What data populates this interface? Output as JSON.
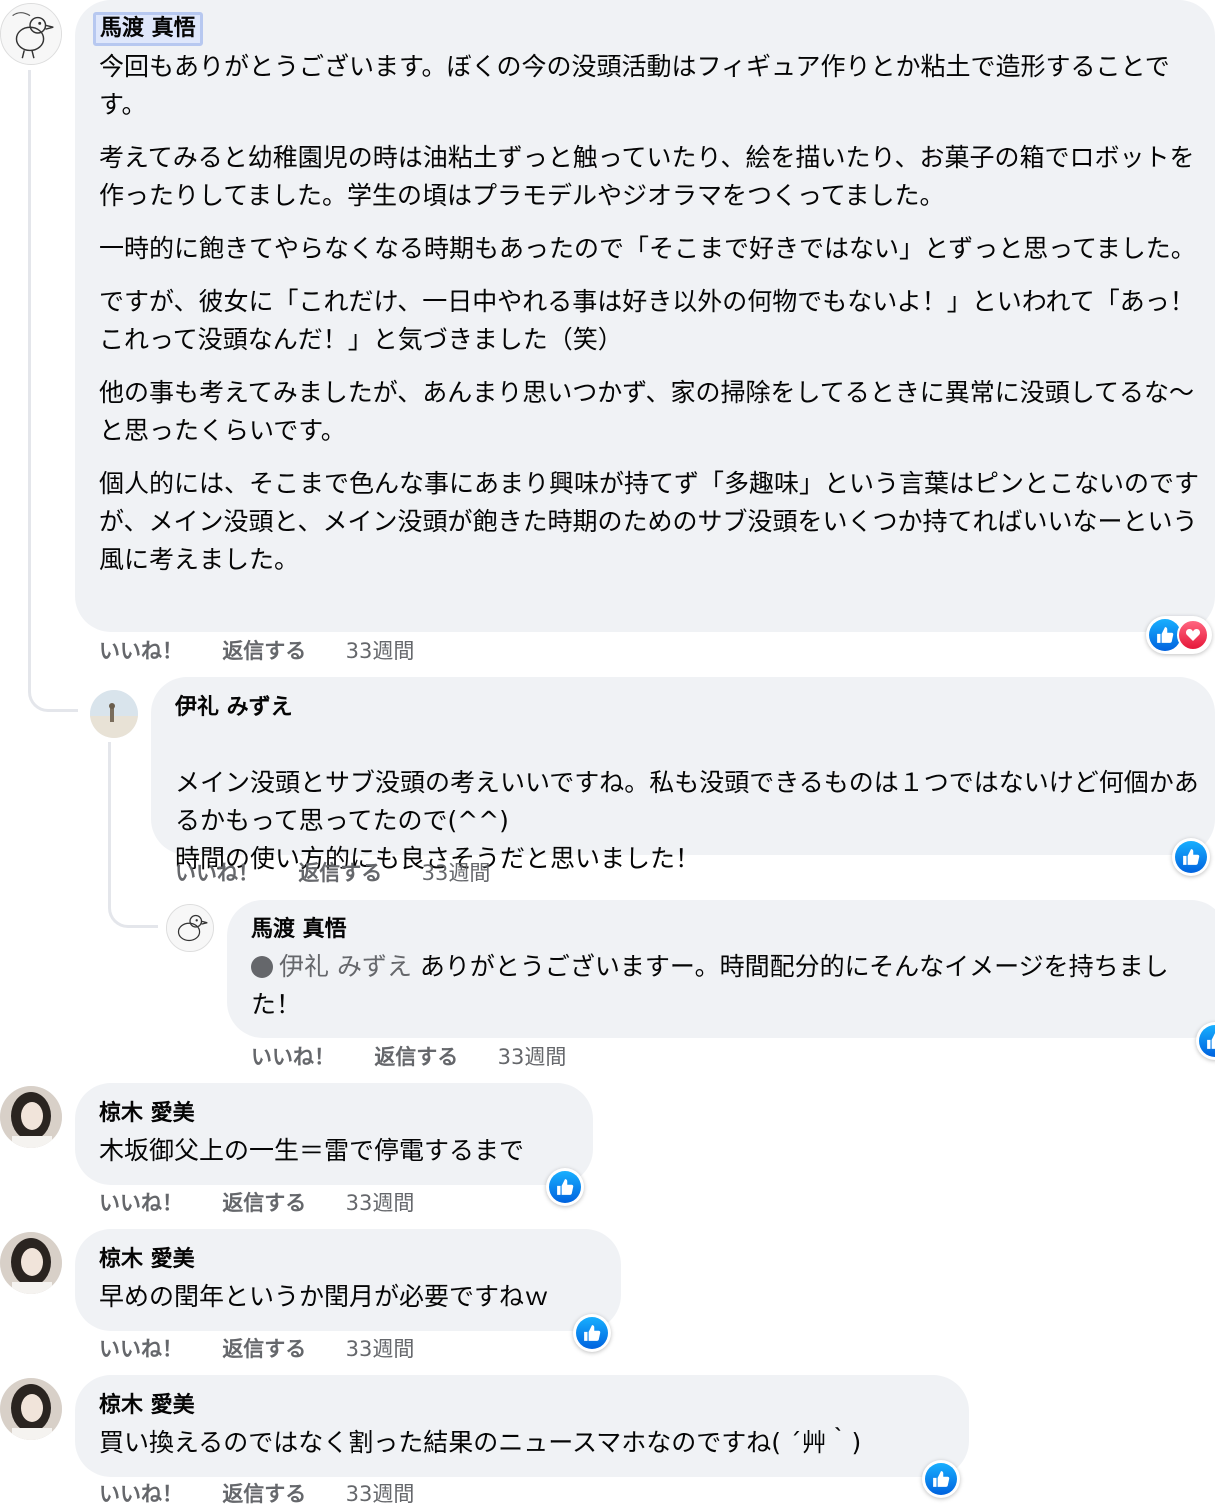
{
  "comments": [
    {
      "author": "馬渡 真悟",
      "paragraphs": [
        "今回もありがとうございます。ぼくの今の没頭活動はフィギュア作りとか粘土で造形することです。",
        "考えてみると幼稚園児の時は油粘土ずっと触っていたり、絵を描いたり、お菓子の箱でロボットを作ったりしてました。学生の頃はプラモデルやジオラマをつくってました。",
        "一時的に飽きてやらなくなる時期もあったので「そこまで好きではない」とずっと思ってました。",
        "ですが、彼女に「これだけ、一日中やれる事は好き以外の何物でもないよ！」といわれて「あっ！これって没頭なんだ！」と気づきました（笑）",
        "他の事も考えてみましたが、あんまり思いつかず、家の掃除をしてるときに異常に没頭してるな〜と思ったくらいです。",
        "個人的には、そこまで色んな事にあまり興味が持てず「多趣味」という言葉はピンとこないのですが、メイン没頭と、メイン没頭が飽きた時期のためのサブ没頭をいくつか持てればいいなーという風に考えました。"
      ],
      "like": "いいね！",
      "reply": "返信する",
      "time": "33週間"
    },
    {
      "author": "伊礼 みずえ",
      "paragraphs": [
        "メイン没頭とサブ没頭の考えいいですね。私も没頭できるものは１つではないけど何個かあるかもって思ってたので(^^)\n時間の使い方的にも良さそうだと思いました！"
      ],
      "like": "いいね！",
      "reply": "返信する",
      "time": "33週間"
    },
    {
      "author": "馬渡 真悟",
      "mention": "伊礼 みずえ",
      "text": " ありがとうございますー。時間配分的にそんなイメージを持ちました！",
      "like": "いいね！",
      "reply": "返信する",
      "time": "33週間"
    },
    {
      "author": "椋木 愛美",
      "text": "木坂御父上の一生＝雷で停電するまで",
      "like": "いいね！",
      "reply": "返信する",
      "time": "33週間"
    },
    {
      "author": "椋木 愛美",
      "text": "早めの閏年というか閏月が必要ですねｗ",
      "like": "いいね！",
      "reply": "返信する",
      "time": "33週間"
    },
    {
      "author": "椋木 愛美",
      "text": "買い換えるのではなく割った結果のニュースマホなのですね( ´艸｀)",
      "like": "いいね！",
      "reply": "返信する",
      "time": "33週間"
    }
  ],
  "reaction_icons": [
    "like-icon",
    "love-icon"
  ],
  "colors": {
    "bubble": "#f0f2f5",
    "meta": "#65676b",
    "like_blue": "#0866ff",
    "love_red": "#f33e58"
  }
}
